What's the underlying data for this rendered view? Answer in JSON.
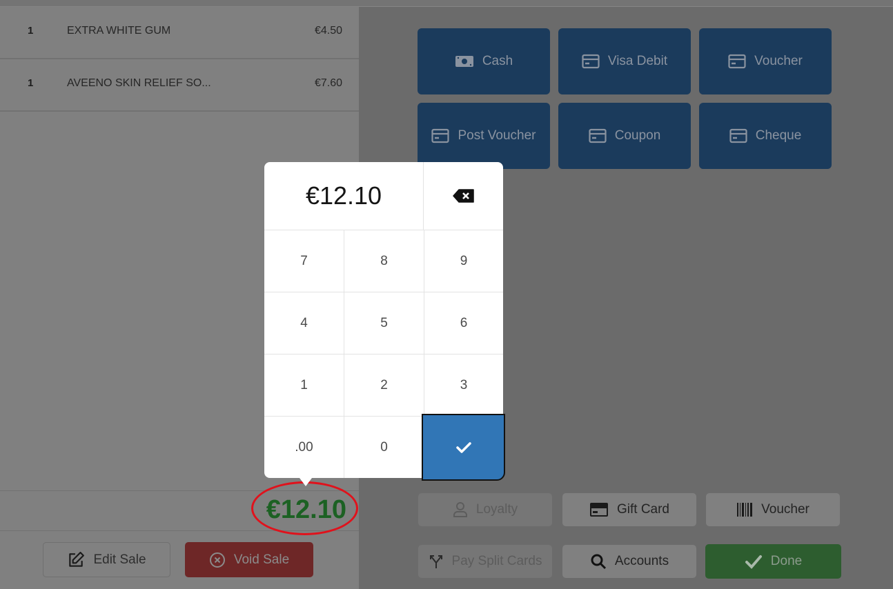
{
  "sale": {
    "items": [
      {
        "qty": "1",
        "name": "EXTRA WHITE GUM",
        "price": "€4.50"
      },
      {
        "qty": "1",
        "name": "AVEENO SKIN RELIEF SO...",
        "price": "€7.60"
      }
    ],
    "total": "€12.10",
    "edit_sale_label": "Edit Sale",
    "void_sale_label": "Void Sale"
  },
  "payment_methods": [
    {
      "label": "Cash",
      "icon": "cash-icon"
    },
    {
      "label": "Visa Debit",
      "icon": "credit-card-icon"
    },
    {
      "label": "Voucher",
      "icon": "credit-card-icon"
    },
    {
      "label": "Post Voucher",
      "icon": "credit-card-icon"
    },
    {
      "label": "Coupon",
      "icon": "credit-card-icon"
    },
    {
      "label": "Cheque",
      "icon": "credit-card-icon"
    }
  ],
  "actions": {
    "loyalty": "Loyalty",
    "gift_card": "Gift Card",
    "voucher": "Voucher",
    "pay_split_cards": "Pay Split Cards",
    "accounts": "Accounts",
    "done": "Done"
  },
  "keypad": {
    "display": "€12.10",
    "keys": [
      "7",
      "8",
      "9",
      "4",
      "5",
      "6",
      "1",
      "2",
      "3",
      ".00",
      "0"
    ]
  },
  "colors": {
    "payment_button": "#1b3b5c",
    "total": "#1c6123",
    "void": "#6e2727",
    "done": "#2d5d2f",
    "enter": "#3176b6",
    "highlight_ring": "#e0121c"
  }
}
